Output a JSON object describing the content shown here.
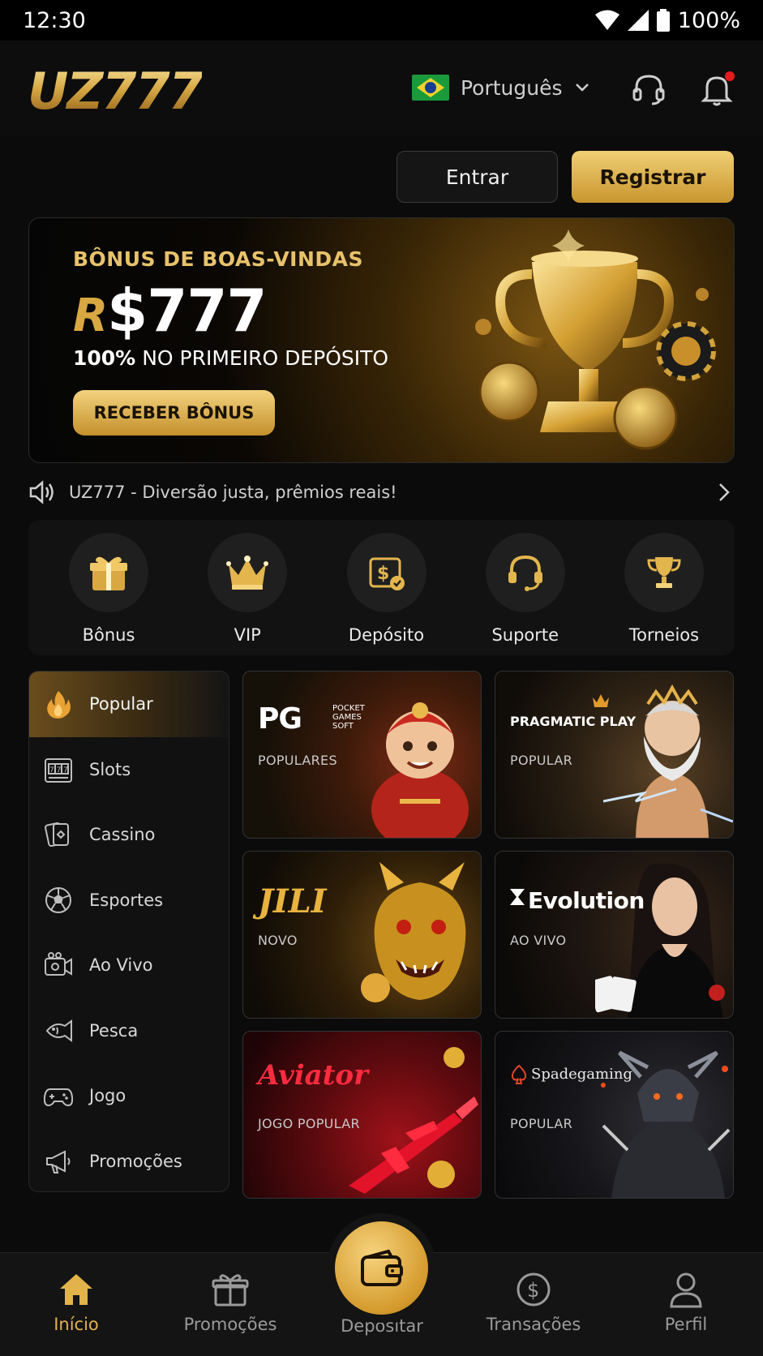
{
  "status": {
    "time": "12:30",
    "battery": "100%"
  },
  "header": {
    "logo": "UZ777",
    "language": "Português"
  },
  "auth": {
    "login": "Entrar",
    "register": "Registrar"
  },
  "banner": {
    "kicker": "BÔNUS DE BOAS-VINDAS",
    "currency": "R",
    "amount": "$777",
    "sub_bold": "100%",
    "sub_rest": "NO PRIMEIRO DEPÓSITO",
    "cta": "RECEBER BÔNUS"
  },
  "marquee": {
    "text": "UZ777 - Diversão justa, prêmios reais!"
  },
  "quick": [
    {
      "label": "Bônus",
      "icon": "gift-icon"
    },
    {
      "label": "VIP",
      "icon": "crown-icon"
    },
    {
      "label": "Depósito",
      "icon": "deposit-icon"
    },
    {
      "label": "Suporte",
      "icon": "headset-icon"
    },
    {
      "label": "Torneios",
      "icon": "trophy-icon"
    }
  ],
  "sidebar": [
    {
      "label": "Popular",
      "icon": "flame-icon"
    },
    {
      "label": "Slots",
      "icon": "slot-machine-icon"
    },
    {
      "label": "Cassino",
      "icon": "cards-icon"
    },
    {
      "label": "Esportes",
      "icon": "soccer-ball-icon"
    },
    {
      "label": "Ao Vivo",
      "icon": "camera-icon"
    },
    {
      "label": "Pesca",
      "icon": "fish-icon"
    },
    {
      "label": "Jogo",
      "icon": "gamepad-icon"
    },
    {
      "label": "Promoções",
      "icon": "megaphone-icon"
    }
  ],
  "providers": [
    {
      "name": "PG",
      "subname": "POCKET GAMES SOFT",
      "tag": "POPULARES"
    },
    {
      "name": "PRAGMATIC PLAY",
      "tag": "POPULAR"
    },
    {
      "name": "JILI",
      "tag": "NOVO"
    },
    {
      "name": "Evolution",
      "tag": "AO VIVO"
    },
    {
      "name": "Aviator",
      "tag": "JOGO POPULAR"
    },
    {
      "name": "Spadegaming",
      "tag": "POPULAR"
    }
  ],
  "bottom_nav": [
    {
      "label": "Início",
      "icon": "home-icon"
    },
    {
      "label": "Promoções",
      "icon": "gift-icon"
    },
    {
      "label": "Depositar",
      "icon": "wallet-icon"
    },
    {
      "label": "Transações",
      "icon": "dollar-icon"
    },
    {
      "label": "Perfil",
      "icon": "user-icon"
    }
  ],
  "colors": {
    "gold": "#d9a842",
    "background": "#0b0b0b",
    "notification": "#e21c1c"
  }
}
